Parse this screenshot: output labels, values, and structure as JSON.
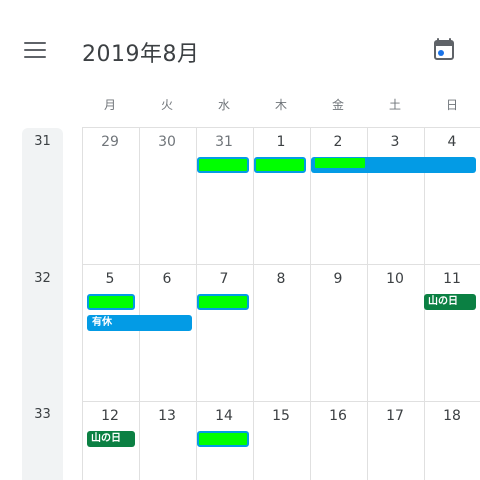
{
  "header": {
    "title": "2019年8月",
    "menu_icon": "hamburger-menu-icon",
    "today_icon": "calendar-today-icon"
  },
  "weekdays": [
    "月",
    "火",
    "水",
    "木",
    "金",
    "土",
    "日"
  ],
  "weeks": [
    {
      "number": "31",
      "days": [
        "29",
        "30",
        "31",
        "1",
        "2",
        "3",
        "4"
      ],
      "muted_days": [
        "29",
        "30",
        "31"
      ]
    },
    {
      "number": "32",
      "days": [
        "5",
        "6",
        "7",
        "8",
        "9",
        "10",
        "11"
      ]
    },
    {
      "number": "33",
      "days": [
        "12",
        "13",
        "14",
        "15",
        "16",
        "17",
        "18"
      ]
    }
  ],
  "events": {
    "holiday_label": "山の日",
    "paid_leave_label": "有休"
  },
  "colors": {
    "accent_blue": "#039be5",
    "holiday_teal": "#0b8043",
    "highlight_green": "#00ff00"
  }
}
